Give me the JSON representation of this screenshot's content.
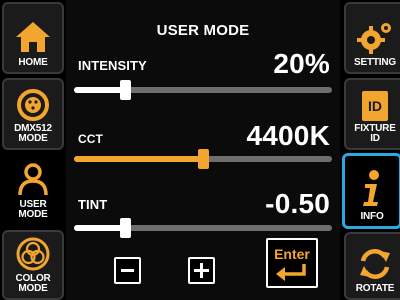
{
  "colors": {
    "accent": "#f2a52f",
    "highlight": "#29a9e0",
    "track": "#6e6e6e",
    "white": "#ffffff"
  },
  "left_menu": [
    {
      "label": "HOME",
      "icon": "home-icon"
    },
    {
      "label": "DMX512 MODE",
      "icon": "dmx-connector-icon"
    },
    {
      "label": "USER MODE",
      "icon": "person-icon",
      "selected": true
    },
    {
      "label": "COLOR MODE",
      "icon": "color-circles-icon"
    }
  ],
  "right_menu": [
    {
      "label": "SETTING",
      "icon": "gear-icon"
    },
    {
      "label": "FIXTURE ID",
      "icon": "id-card-icon",
      "icon_text": "ID"
    },
    {
      "label": "INFO",
      "icon": "info-icon",
      "active": true
    },
    {
      "label": "ROTATE",
      "icon": "rotate-icon"
    }
  ],
  "main": {
    "title": "USER MODE",
    "sliders": [
      {
        "label": "INTENSITY",
        "value": "20%",
        "level": 0.2,
        "color": "white"
      },
      {
        "label": "CCT",
        "value": "4400K",
        "level": 0.5,
        "color": "accent"
      },
      {
        "label": "TINT",
        "value": "-0.50",
        "level": 0.2,
        "color": "white"
      }
    ],
    "buttons": {
      "minus": "−",
      "plus": "+",
      "enter": "Enter"
    }
  }
}
